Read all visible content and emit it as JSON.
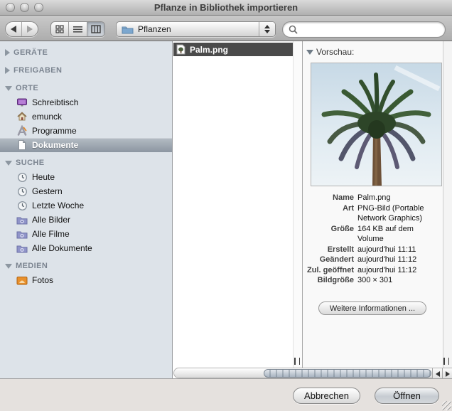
{
  "window": {
    "title": "Pflanze in Bibliothek importieren"
  },
  "toolbar": {
    "location": {
      "value": "Pflanzen",
      "icon": "folder-icon"
    },
    "search": {
      "value": "",
      "icon": "search-icon"
    },
    "view_modes": [
      {
        "name": "icon-view",
        "selected": false
      },
      {
        "name": "list-view",
        "selected": false
      },
      {
        "name": "column-view",
        "selected": true
      }
    ]
  },
  "sidebar": {
    "sections": [
      {
        "label": "GERÄTE",
        "expanded": false,
        "items": []
      },
      {
        "label": "FREIGABEN",
        "expanded": false,
        "items": []
      },
      {
        "label": "ORTE",
        "expanded": true,
        "items": [
          {
            "label": "Schreibtisch",
            "icon": "desktop-icon",
            "selected": false
          },
          {
            "label": "emunck",
            "icon": "home-icon",
            "selected": false
          },
          {
            "label": "Programme",
            "icon": "applications-icon",
            "selected": false
          },
          {
            "label": "Dokumente",
            "icon": "documents-icon",
            "selected": true
          }
        ]
      },
      {
        "label": "SUCHE",
        "expanded": true,
        "items": [
          {
            "label": "Heute",
            "icon": "clock-icon",
            "selected": false
          },
          {
            "label": "Gestern",
            "icon": "clock-icon",
            "selected": false
          },
          {
            "label": "Letzte Woche",
            "icon": "clock-icon",
            "selected": false
          },
          {
            "label": "Alle Bilder",
            "icon": "smart-folder-icon",
            "selected": false
          },
          {
            "label": "Alle Filme",
            "icon": "smart-folder-icon",
            "selected": false
          },
          {
            "label": "Alle Dokumente",
            "icon": "smart-folder-icon",
            "selected": false
          }
        ]
      },
      {
        "label": "MEDIEN",
        "expanded": true,
        "items": [
          {
            "label": "Fotos",
            "icon": "photos-icon",
            "selected": false
          }
        ]
      }
    ]
  },
  "file_list": {
    "items": [
      {
        "name": "Palm.png",
        "icon": "image-file-icon",
        "selected": true
      }
    ]
  },
  "preview": {
    "header": "Vorschau:",
    "image": "palm-tree-photo",
    "details": [
      {
        "label": "Name",
        "value": "Palm.png"
      },
      {
        "label": "Art",
        "value": "PNG-Bild (Portable Network Graphics)"
      },
      {
        "label": "Größe",
        "value": "164 KB auf dem Volume"
      },
      {
        "label": "Erstellt",
        "value": "aujourd'hui 11:11"
      },
      {
        "label": "Geändert",
        "value": "aujourd'hui 11:12"
      },
      {
        "label": "Zul. geöffnet",
        "value": "aujourd'hui 11:12"
      },
      {
        "label": "Bildgröße",
        "value": "300 × 301"
      }
    ],
    "more_info_label": "Weitere Informationen ..."
  },
  "footer": {
    "cancel_label": "Abbrechen",
    "open_label": "Öffnen"
  },
  "colors": {
    "selection_dark": "#4a4a4a",
    "sidebar_bg": "#dde3e9",
    "sidebar_selection_top": "#b4bcc4",
    "sidebar_selection_bottom": "#8c96a1",
    "titlebar_top": "#dadada",
    "titlebar_bottom": "#b0b0b0",
    "footer_bg": "#e5e1de"
  }
}
